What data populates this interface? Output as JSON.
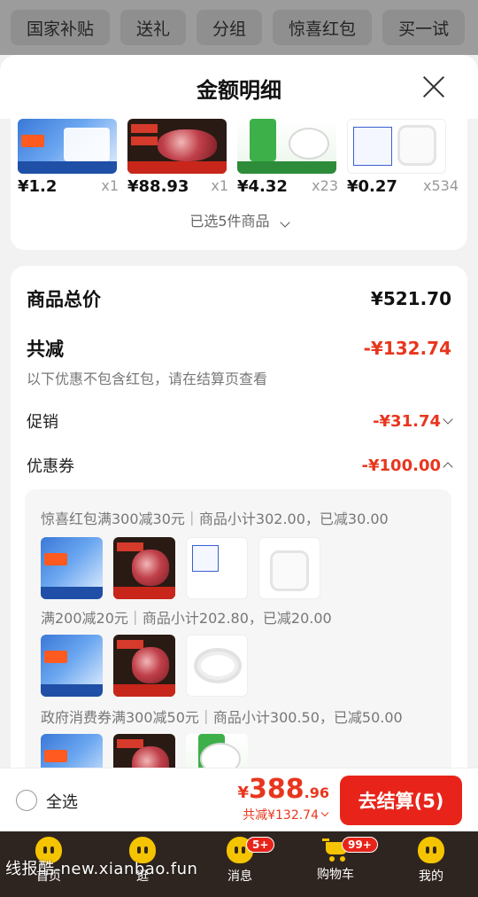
{
  "topbar": {
    "chips": [
      "国家补贴",
      "送礼",
      "分组",
      "惊喜红包",
      "买一试"
    ]
  },
  "sheet": {
    "title": "金额明细",
    "items": [
      {
        "price": "¥1.2",
        "qty": "x1",
        "image": "seasoning-pack"
      },
      {
        "price": "¥88.93",
        "qty": "x1",
        "image": "beef"
      },
      {
        "price": "¥4.32",
        "qty": "x23",
        "image": "detergent"
      },
      {
        "price": "¥0.27",
        "qty": "x534",
        "image": "plastic-cup"
      }
    ],
    "selected_count": "已选5件商品"
  },
  "summary": {
    "total_label": "商品总价",
    "total_value": "¥521.70",
    "reduce_label": "共减",
    "reduce_value": "-¥132.74",
    "reduce_note": "以下优惠不包含红包，请在结算页查看",
    "promo_label": "促销",
    "promo_value": "-¥31.74",
    "coupon_label": "优惠券",
    "coupon_value": "-¥100.00",
    "coupons": [
      {
        "text": "惊喜红包满300减30元｜商品小计302.00，已减30.00",
        "images": [
          "seasoning-pack",
          "beef",
          "label-card",
          "plastic-cup"
        ]
      },
      {
        "text": "满200减20元｜商品小计202.80，已减20.00",
        "images": [
          "seasoning-pack",
          "beef",
          "tube-coil"
        ]
      },
      {
        "text": "政府消费券满300减50元｜商品小计300.50，已减50.00",
        "images": [
          "seasoning-pack",
          "beef",
          "detergent"
        ]
      }
    ]
  },
  "checkout": {
    "select_all": "全选",
    "currency": "¥",
    "amount_int": "388",
    "amount_dec": ".96",
    "reduce_note": "共减¥132.74",
    "button": "去结算(5)"
  },
  "tabbar": {
    "tabs": [
      {
        "label": "首页",
        "badge": ""
      },
      {
        "label": "逛",
        "badge": ""
      },
      {
        "label": "消息",
        "badge": "5+"
      },
      {
        "label": "购物车",
        "badge": "99+"
      },
      {
        "label": "我的",
        "badge": ""
      }
    ]
  },
  "watermark": "线报酷-new.xianbao.fun",
  "colors": {
    "accent_red": "#e8361e",
    "button_red": "#e8241a",
    "tabbar_bg": "#2f2520",
    "icon_yellow": "#f5c400"
  }
}
